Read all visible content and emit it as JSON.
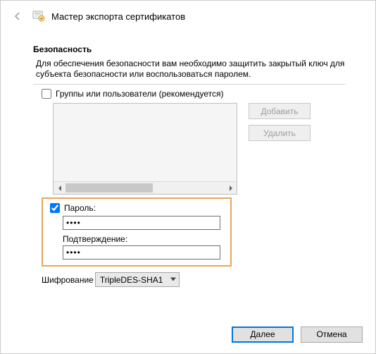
{
  "window": {
    "title": "Мастер экспорта сертификатов"
  },
  "page": {
    "heading": "Безопасность",
    "subtitle": "Для обеспечения безопасности вам необходимо защитить закрытый ключ для субъекта безопасности или воспользоваться паролем."
  },
  "groups": {
    "checkbox_label": "Группы или пользователи (рекомендуется)",
    "checked": false,
    "add_label": "Добавить",
    "remove_label": "Удалить"
  },
  "password": {
    "checkbox_label": "Пароль:",
    "checked": true,
    "value": "••••",
    "confirm_label": "Подтверждение:",
    "confirm_value": "••••"
  },
  "encryption": {
    "label": "Шифрование",
    "selected": "TripleDES-SHA1"
  },
  "footer": {
    "next": "Далее",
    "cancel": "Отмена"
  }
}
